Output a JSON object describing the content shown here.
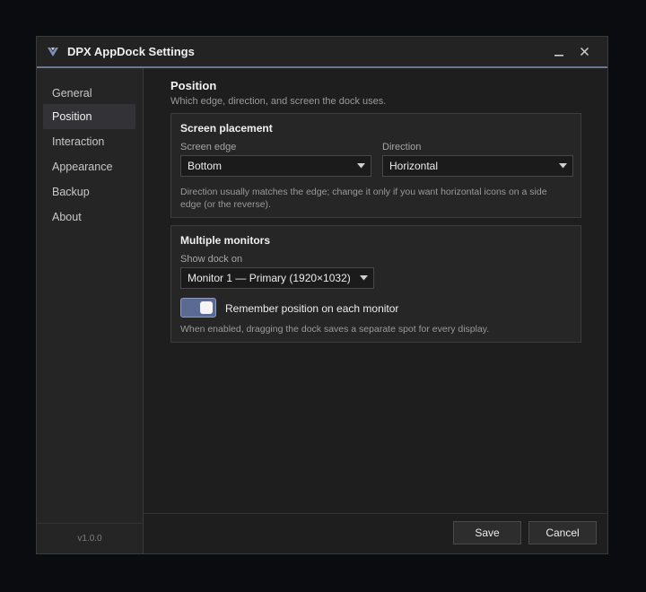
{
  "window": {
    "title": "DPX AppDock Settings",
    "minimize_glyph": "—",
    "close_glyph": "✕"
  },
  "sidebar": {
    "items": [
      {
        "label": "General",
        "active": false
      },
      {
        "label": "Position",
        "active": true
      },
      {
        "label": "Interaction",
        "active": false
      },
      {
        "label": "Appearance",
        "active": false
      },
      {
        "label": "Backup",
        "active": false
      },
      {
        "label": "About",
        "active": false
      }
    ],
    "version": "v1.0.0"
  },
  "page": {
    "title": "Position",
    "subtitle": "Which edge, direction, and screen the dock uses."
  },
  "screen_placement": {
    "title": "Screen placement",
    "edge_label": "Screen edge",
    "edge_value": "Bottom",
    "direction_label": "Direction",
    "direction_value": "Horizontal",
    "help_line1": "Direction usually matches the edge; change it only if you want horizontal icons on a side",
    "help_line2": "edge (or the reverse)."
  },
  "multiple_monitors": {
    "title": "Multiple monitors",
    "show_label": "Show dock on",
    "monitor_value": "Monitor 1 — Primary (1920×1032)",
    "toggle_label": "Remember position on each monitor",
    "toggle_on": true,
    "help": "When enabled, dragging the dock saves a separate spot for every display."
  },
  "footer": {
    "save_label": "Save",
    "cancel_label": "Cancel"
  },
  "colors": {
    "accent": "#5a6a93",
    "title_underline": "#6b7691",
    "background": "#1e1e1e"
  }
}
